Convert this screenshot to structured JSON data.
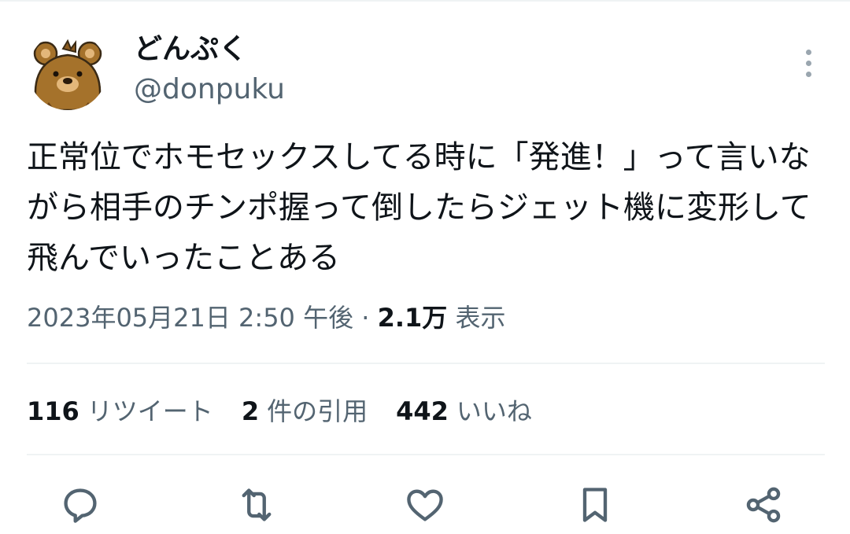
{
  "user": {
    "display_name": "どんぷく",
    "handle": "@donpuku"
  },
  "tweet": {
    "text": "正常位でホモセックスしてる時に「発進！」って言いながら相手のチンポ握って倒したらジェット機に変形して飛んでいったことある"
  },
  "meta": {
    "timestamp": "2023年05月21日 2:50 午後",
    "separator": " · ",
    "views_count": "2.1万",
    "views_label": "表示"
  },
  "stats": {
    "retweets": {
      "count": "116",
      "label": "リツイート"
    },
    "quotes": {
      "count": "2",
      "label": "件の引用"
    },
    "likes": {
      "count": "442",
      "label": "いいね"
    }
  },
  "icons": {
    "more": "more-vertical-icon",
    "reply": "reply-icon",
    "retweet": "retweet-icon",
    "like": "heart-icon",
    "bookmark": "bookmark-icon",
    "share": "share-icon"
  },
  "colors": {
    "text_primary": "#0f1419",
    "text_secondary": "#536471",
    "divider": "#eff3f4",
    "icon": "#536471",
    "avatar_bear": "#a5722b"
  }
}
